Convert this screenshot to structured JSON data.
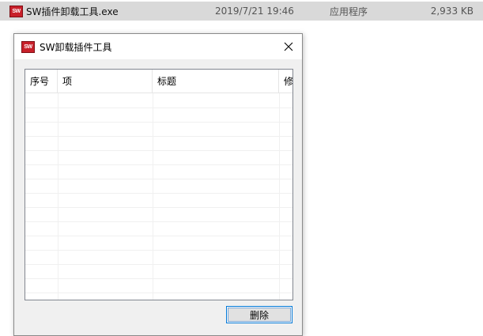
{
  "file_row": {
    "icon": "sw-app-icon",
    "icon_text": "SW",
    "name": "SW插件卸载工具.exe",
    "date": "2019/7/21 19:46",
    "type": "应用程序",
    "size": "2,933 KB"
  },
  "dialog": {
    "title": "SW卸载插件工具",
    "icon_text": "SW",
    "close_icon": "close-icon",
    "columns": [
      "序号",
      "项",
      "标题",
      "修"
    ],
    "rows": [],
    "delete_label": "删除"
  },
  "colors": {
    "row_highlight": "#d9d9d9",
    "dialog_bg": "#f0f0f0",
    "app_icon_red": "#c8202a",
    "focus_blue": "#0078d7"
  }
}
